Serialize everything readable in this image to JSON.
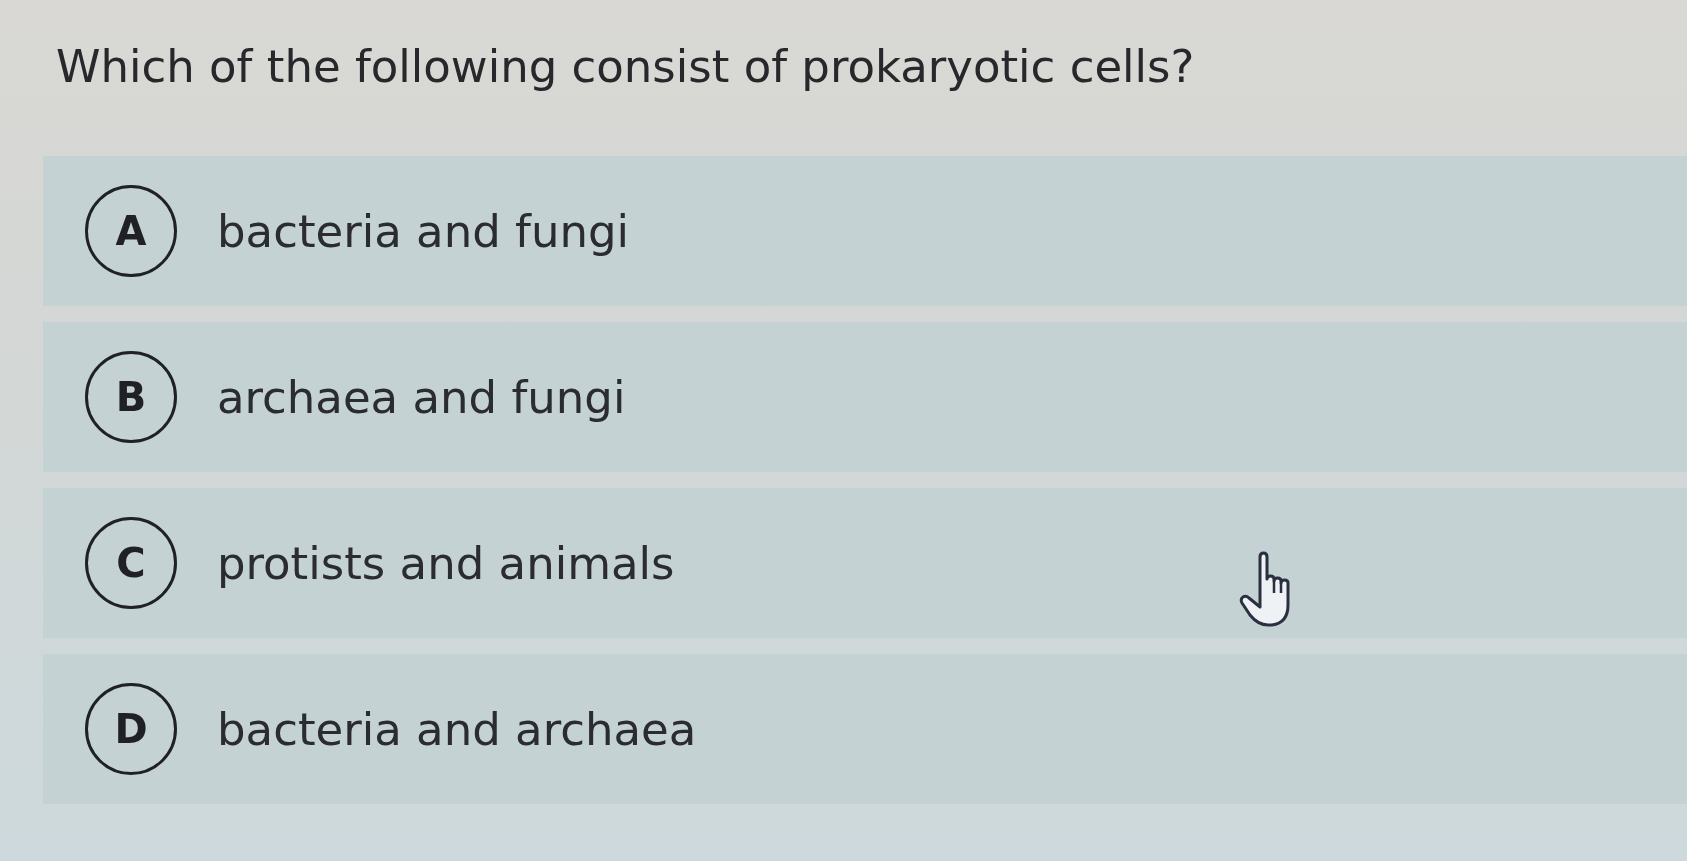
{
  "question": "Which of the following consist of prokaryotic cells?",
  "options": [
    {
      "letter": "A",
      "text": "bacteria and fungi"
    },
    {
      "letter": "B",
      "text": "archaea and fungi"
    },
    {
      "letter": "C",
      "text": "protists and animals"
    },
    {
      "letter": "D",
      "text": "bacteria and archaea"
    }
  ]
}
